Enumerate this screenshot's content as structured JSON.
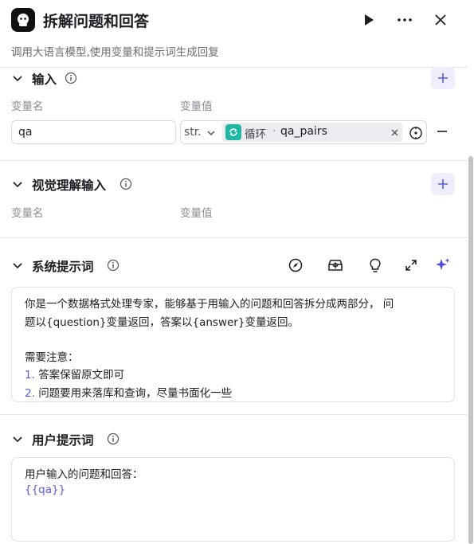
{
  "header": {
    "title": "拆解问题和回答",
    "subtitle": "调用大语言模型,使用变量和提示词生成回复"
  },
  "input_section": {
    "title": "输入",
    "col_name": "变量名",
    "col_value": "变量值",
    "row": {
      "name": "qa",
      "type": "str.",
      "ref_node": "循环",
      "ref_sep": "·",
      "ref_var": "qa_pairs"
    }
  },
  "vision_section": {
    "title": "视觉理解输入",
    "col_name": "变量名",
    "col_value": "变量值"
  },
  "system_section": {
    "title": "系统提示词",
    "lines": [
      "你是一个数据格式处理专家，能够基于用输入的问题和回答拆分成两部分， 问",
      "题以{question}变量返回，答案以{answer}变量返回。",
      "需要注意："
    ],
    "items": [
      {
        "num": "1.",
        "text": "答案保留原文即可"
      },
      {
        "num": "2.",
        "text": "问题要用来落库和查询，尽量书面化一些"
      }
    ]
  },
  "user_section": {
    "title": "用户提示词",
    "line1": "用户输入的问题和回答：",
    "var": "{{qa}}"
  },
  "colors": {
    "accent": "#5a5ad8",
    "teal": "#1fb8a4"
  }
}
